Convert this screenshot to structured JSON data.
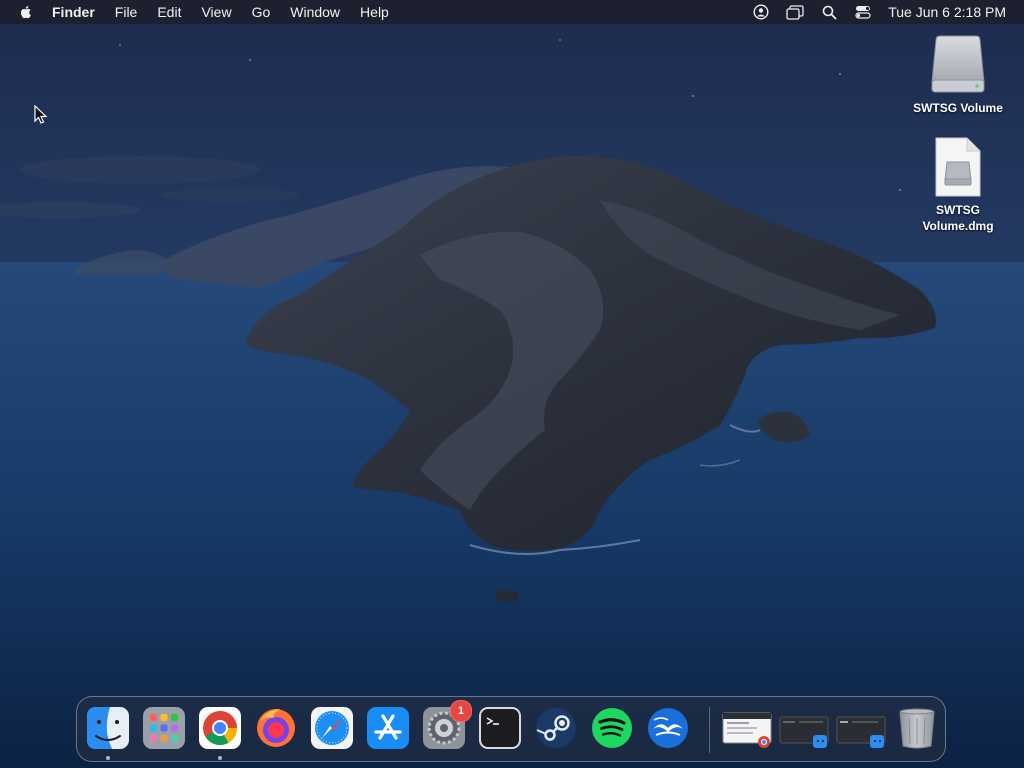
{
  "menubar": {
    "app_name": "Finder",
    "menus": [
      "File",
      "Edit",
      "View",
      "Go",
      "Window",
      "Help"
    ],
    "status_icons": [
      "user-icon",
      "screen-mirroring-icon",
      "search-icon",
      "control-center-icon"
    ],
    "clock": "Tue Jun 6  2:18 PM"
  },
  "desktop_icons": [
    {
      "label": "SWTSG Volume",
      "icon": "external-drive-icon"
    },
    {
      "label": "SWTSG\nVolume.dmg",
      "icon": "dmg-file-icon"
    }
  ],
  "dock": {
    "apps": [
      {
        "name": "Finder",
        "icon": "finder-icon",
        "running": true
      },
      {
        "name": "Launchpad",
        "icon": "launchpad-icon",
        "running": false
      },
      {
        "name": "Google Chrome",
        "icon": "chrome-icon",
        "running": true
      },
      {
        "name": "Firefox",
        "icon": "firefox-icon",
        "running": false
      },
      {
        "name": "Safari",
        "icon": "safari-icon",
        "running": false
      },
      {
        "name": "App Store",
        "icon": "app-store-icon",
        "running": false
      },
      {
        "name": "System Preferences",
        "icon": "system-preferences-icon",
        "running": false,
        "badge": "1"
      },
      {
        "name": "Terminal",
        "icon": "terminal-icon",
        "running": false
      },
      {
        "name": "Steam",
        "icon": "steam-icon",
        "running": false
      },
      {
        "name": "Spotify",
        "icon": "spotify-icon",
        "running": false
      },
      {
        "name": "Mail",
        "icon": "mail-icon",
        "running": false
      }
    ],
    "minimized_windows": [
      {
        "icon": "chrome-window-thumbnail"
      },
      {
        "icon": "finder-window-thumbnail"
      },
      {
        "icon": "finder-window-thumbnail"
      }
    ],
    "trash_icon": "trash-icon"
  },
  "colors": {
    "menubar_bg": "#1c202c",
    "badge_red": "#e8463f",
    "spotify_green": "#1ed760"
  }
}
